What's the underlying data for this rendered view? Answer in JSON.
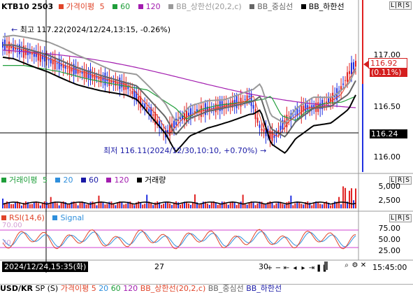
{
  "main_legend": {
    "symbol": "KTB10 2503",
    "ma_label": "가격이평",
    "ma_periods": [
      "5",
      "60",
      "120"
    ],
    "bb_upper": "BB_상한선(20,2,c)",
    "bb_mid": "BB_중심선",
    "bb_lower": "BB_하한선",
    "colors": {
      "ma5": "#e0452a",
      "ma60": "#1f9e3a",
      "ma120": "#a21caf",
      "bb_upper": "#9a9a9a",
      "bb_mid": "#666666",
      "bb_lower": "#000000"
    }
  },
  "annotations": {
    "high": "최고 117.22(2024/12/24,13:15, -0.26%)",
    "low": "최저 116.11(2024/12/30,10:10, +0.70%)"
  },
  "price_axis": {
    "ticks": [
      "117.00",
      "116.50",
      "116.00"
    ],
    "current_price": "116.92",
    "current_change": "(0.11%)",
    "crosshair_price": "116.24"
  },
  "volume_legend": {
    "label": "거래이평",
    "periods": [
      "5",
      "20",
      "60",
      "120"
    ],
    "volume_label": "거래량",
    "axis_ticks": [
      "5,000",
      "2,500"
    ]
  },
  "rsi_legend": {
    "label": "RSI(14,6)",
    "signal": "Signal",
    "level_high": "70.00",
    "level_low": "30",
    "axis_ticks": [
      "75.00",
      "50.00",
      "25.00"
    ]
  },
  "time_axis": {
    "crosshair_time": "2024/12/24,15:35(화)",
    "labels": [
      "27",
      "30"
    ],
    "right_time": "15:45:00"
  },
  "bottom_bar": {
    "symbol": "USD/KR",
    "sp": "SP",
    "s": "(S)",
    "ma_label": "가격이평",
    "ma5": "5",
    "ma20": "20",
    "ma60": "60",
    "ma120": "120",
    "bb_upper": "BB_상한선(20,2,c)",
    "bb_mid": "BB_중심선",
    "bb_lower": "BB_하한선"
  },
  "toolbar_icons": [
    "zoom-in-icon",
    "zoom-out-icon",
    "search-icon",
    "settings-icon",
    "close-icon"
  ]
}
